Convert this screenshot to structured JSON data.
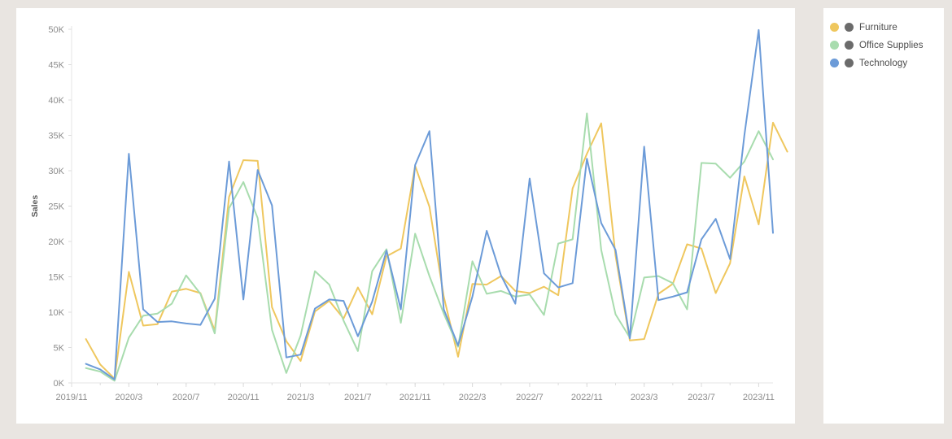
{
  "theme": {
    "page_background": "#e9e5e1",
    "card_background": "#ffffff",
    "axis_text_color": "#8c8c8c",
    "axis_title_color": "#5a5a5a"
  },
  "legend": {
    "position": "right",
    "items": [
      {
        "label": "Furniture",
        "color": "#efc75e",
        "mark_color": "#6b6b6b"
      },
      {
        "label": "Office Supplies",
        "color": "#a8dcae",
        "mark_color": "#6b6b6b"
      },
      {
        "label": "Technology",
        "color": "#6c9bd8",
        "mark_color": "#6b6b6b"
      }
    ]
  },
  "chart_data": {
    "type": "line",
    "title": "",
    "subtitle": "",
    "xlabel": "",
    "ylabel": "Sales",
    "grid": false,
    "legend_position": "right",
    "ylim": [
      0,
      50000
    ],
    "ytick_labels": [
      "0K",
      "5K",
      "10K",
      "15K",
      "20K",
      "25K",
      "30K",
      "35K",
      "40K",
      "45K",
      "50K"
    ],
    "ytick_values": [
      0,
      5000,
      10000,
      15000,
      20000,
      25000,
      30000,
      35000,
      40000,
      45000,
      50000
    ],
    "x": [
      "2019/12",
      "2020/1",
      "2020/2",
      "2020/3",
      "2020/4",
      "2020/5",
      "2020/6",
      "2020/7",
      "2020/8",
      "2020/9",
      "2020/10",
      "2020/11",
      "2020/12",
      "2021/1",
      "2021/2",
      "2021/3",
      "2021/4",
      "2021/5",
      "2021/6",
      "2021/7",
      "2021/8",
      "2021/9",
      "2021/10",
      "2021/11",
      "2021/12",
      "2022/1",
      "2022/2",
      "2022/3",
      "2022/4",
      "2022/5",
      "2022/6",
      "2022/7",
      "2022/8",
      "2022/9",
      "2022/10",
      "2022/11",
      "2022/12",
      "2023/1",
      "2023/2",
      "2023/3",
      "2023/4",
      "2023/5",
      "2023/6",
      "2023/7",
      "2023/8",
      "2023/9",
      "2023/10",
      "2023/11",
      "2023/12"
    ],
    "xtick_labels": [
      "2019/11",
      "2020/3",
      "2020/7",
      "2020/11",
      "2021/3",
      "2021/7",
      "2021/11",
      "2022/3",
      "2022/7",
      "2022/11",
      "2023/3",
      "2023/7",
      "2023/11"
    ],
    "xtick_indices": [
      -1,
      3,
      7,
      11,
      15,
      19,
      23,
      27,
      31,
      35,
      39,
      43,
      47
    ],
    "series": [
      {
        "name": "Furniture",
        "color": "#efc75e",
        "values": [
          6200,
          2600,
          600,
          15700,
          8100,
          8300,
          12900,
          13300,
          12700,
          7400,
          26300,
          31500,
          31400,
          10700,
          5900,
          3100,
          10100,
          11600,
          9100,
          13500,
          9700,
          17900,
          19000,
          30700,
          24900,
          12200,
          3700,
          14000,
          13900,
          15100,
          13000,
          12700,
          13600,
          12400,
          27500,
          32400,
          36700,
          18000,
          6000,
          6200,
          12600,
          14000,
          19600,
          19000,
          12700,
          16900,
          29200,
          22400,
          36800,
          32700
        ]
      },
      {
        "name": "Office Supplies",
        "color": "#a8dcae",
        "values": [
          2100,
          1600,
          300,
          6400,
          9500,
          9800,
          11200,
          15200,
          12600,
          7000,
          24700,
          28400,
          23300,
          7500,
          1400,
          6700,
          15800,
          13900,
          8800,
          4500,
          15800,
          18900,
          8500,
          21100,
          15100,
          9800,
          5100,
          17200,
          12600,
          13000,
          12200,
          12500,
          9600,
          19700,
          20300,
          38100,
          18800,
          9700,
          6400,
          14900,
          15100,
          14100,
          10400,
          31100,
          31000,
          29000,
          31300,
          35600,
          31600
        ]
      },
      {
        "name": "Technology",
        "color": "#6c9bd8",
        "values": [
          2700,
          1900,
          500,
          32400,
          10400,
          8600,
          8700,
          8400,
          8200,
          11900,
          31300,
          11800,
          30100,
          25100,
          3600,
          4000,
          10500,
          11800,
          11600,
          6600,
          11500,
          18700,
          10400,
          30800,
          35600,
          10400,
          5300,
          12200,
          21500,
          15200,
          11200,
          28900,
          15500,
          13500,
          14100,
          31700,
          22600,
          18800,
          6300,
          33400,
          11700,
          12200,
          12800,
          20300,
          23200,
          17500,
          35000,
          49900,
          21200
        ]
      }
    ]
  }
}
